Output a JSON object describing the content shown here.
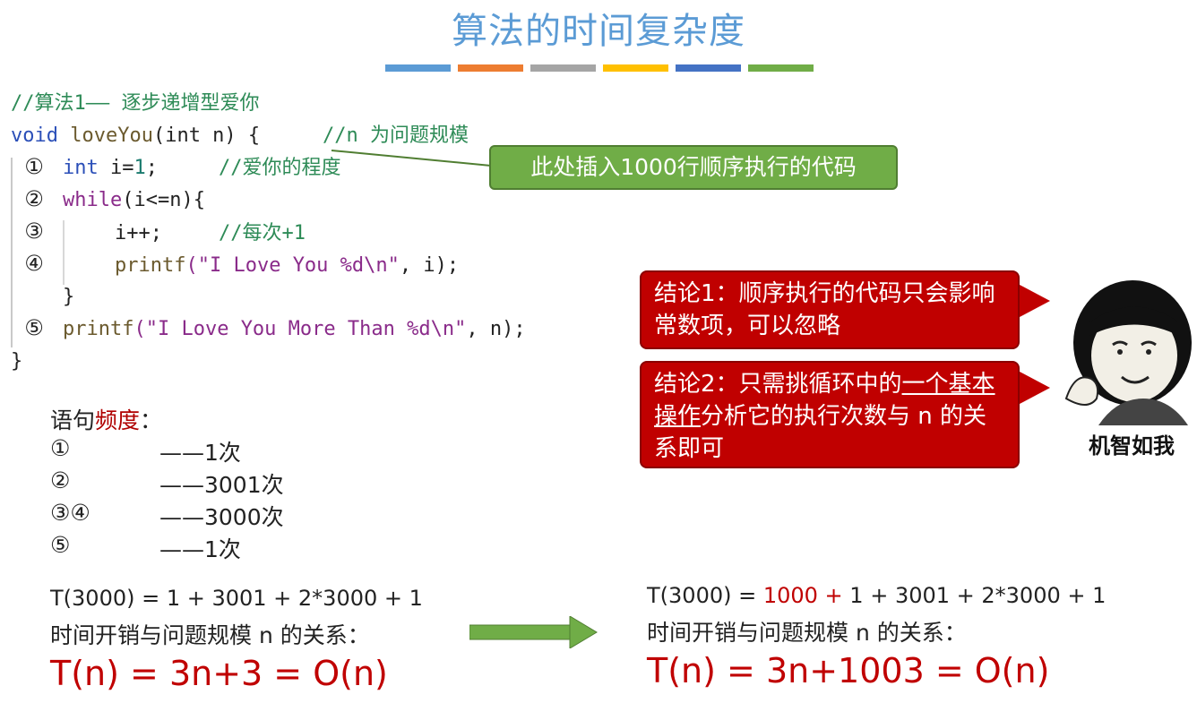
{
  "title": "算法的时间复杂度",
  "colors": {
    "title": "#5b9bd5",
    "bars": [
      "#5b9bd5",
      "#ed7d31",
      "#a5a5a5",
      "#ffc000",
      "#4472c4",
      "#70ad47"
    ],
    "callout_green": "#70ad47",
    "callout_red": "#c00000",
    "emphasis_red": "#c00000"
  },
  "code": {
    "comment_header": "//算法1—— 逐步递增型爱你",
    "sig": {
      "kw": "void",
      "fn": "loveYou",
      "params": "(int n) {",
      "comment": "//n 为问题规模"
    },
    "lines": [
      {
        "marker": "①",
        "kw": "int",
        "rest": " i=",
        "num": "1",
        "tail": ";",
        "comment": "//爱你的程度"
      },
      {
        "marker": "②",
        "kw": "while",
        "rest": "(i<=n){"
      },
      {
        "marker": "③",
        "code": "i++;",
        "comment": "//每次+1"
      },
      {
        "marker": "④",
        "fn": "printf",
        "str": "(\"I Love You %d\\n\"",
        "tail": ", i);"
      },
      {
        "close": "}"
      },
      {
        "marker": "⑤",
        "fn": "printf",
        "str": "(\"I Love You More Than %d\\n\"",
        "tail": ", n);"
      }
    ],
    "closing": "}"
  },
  "callout_green": "此处插入1000行顺序执行的代码",
  "conclusion1": {
    "text": "结论1：顺序执行的代码只会影响常数项，可以忽略"
  },
  "conclusion2": {
    "pre": "结论2：只需挑循环中的",
    "underlined": "一个基本操作",
    "post": "分析它的执行次数与 n 的关系即可"
  },
  "face_caption": "机智如我",
  "frequency": {
    "heading_pre": "语句",
    "heading_red": "频度",
    "heading_post": "：",
    "rows": [
      {
        "marker": "①",
        "value": "——1次"
      },
      {
        "marker": "②",
        "value": "——3001次"
      },
      {
        "marker": "③④",
        "value": "——3000次"
      },
      {
        "marker": "⑤",
        "value": "——1次"
      }
    ]
  },
  "left_formula": {
    "t": "T(3000) = 1 + 3001 + 2*3000 + 1",
    "relation": "时间开销与问题规模 n 的关系：",
    "result": "T(n) = 3n+3 = O(n)"
  },
  "right_formula": {
    "t_pre": "T(3000) = ",
    "t_red": "1000 +",
    "t_post": " 1 + 3001 + 2*3000 + 1",
    "relation": "时间开销与问题规模 n 的关系：",
    "result": "T(n) = 3n+1003 = O(n)"
  }
}
